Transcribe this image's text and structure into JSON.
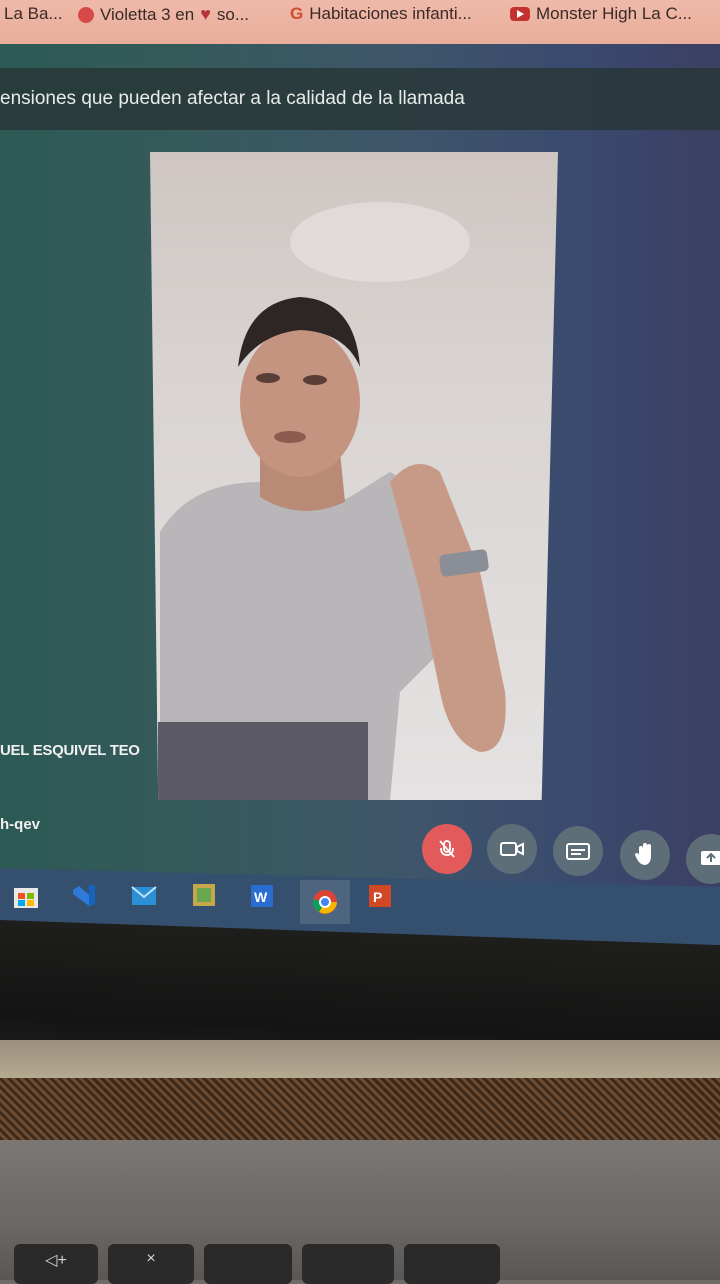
{
  "bookmarks": [
    {
      "label": "La Ba...",
      "icon": "bookmark-favicon"
    },
    {
      "label": "Violetta 3 en",
      "icon": "youtube-icon",
      "suffix": "so..."
    },
    {
      "label": "Habitaciones infanti...",
      "icon": "google-icon"
    },
    {
      "label": "Monster High La C...",
      "icon": "youtube-icon"
    }
  ],
  "meeting": {
    "banner": "ensiones que pueden afectar a la calidad de la llamada",
    "participant_name": "UEL ESQUIVEL TEO",
    "meeting_code": "h-qev"
  },
  "controls": [
    {
      "name": "mic-muted",
      "icon": "mic-off-icon",
      "color": "#e25a5a"
    },
    {
      "name": "camera",
      "icon": "camera-icon"
    },
    {
      "name": "captions",
      "icon": "captions-icon"
    },
    {
      "name": "raise-hand",
      "icon": "hand-icon"
    },
    {
      "name": "present",
      "icon": "present-icon"
    }
  ],
  "taskbar": [
    "store-icon",
    "visual-studio-icon",
    "mail-icon",
    "photos-icon",
    "word-icon",
    "chrome-icon",
    "powerpoint-icon"
  ],
  "keys": [
    "◁+",
    "×"
  ]
}
